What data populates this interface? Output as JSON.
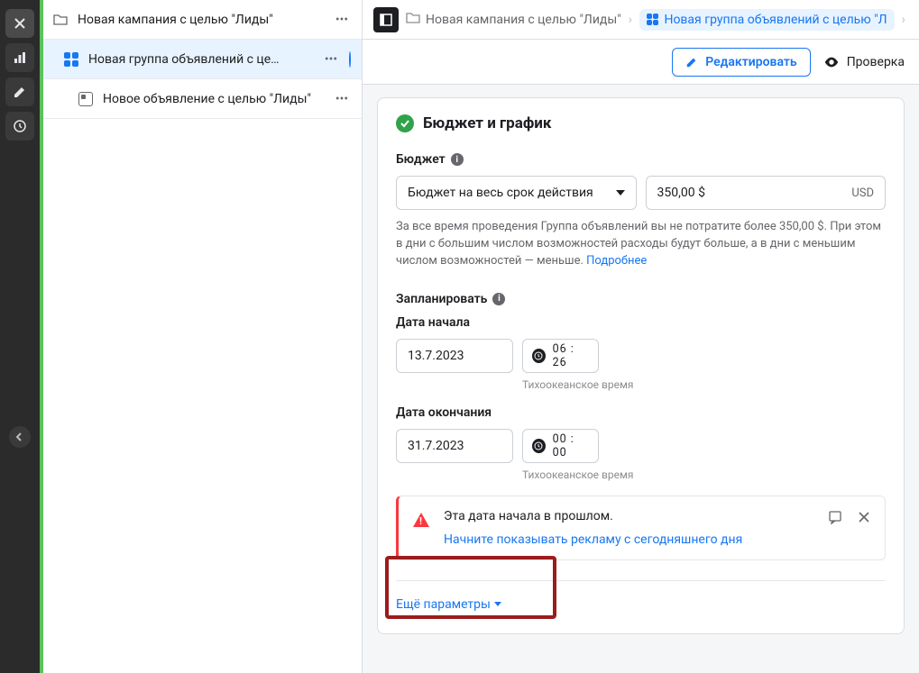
{
  "tree": {
    "campaign": "Новая кампания с целью \"Лиды\"",
    "adset": "Новая группа объявлений с це…",
    "ad": "Новое объявление с целью \"Лиды\""
  },
  "crumbs": {
    "campaign": "Новая кампания с целью \"Лиды\"",
    "adset": "Новая группа объявлений с целью \"Л"
  },
  "actions": {
    "edit": "Редактировать",
    "review": "Проверка"
  },
  "card": {
    "title": "Бюджет и график",
    "budget_label": "Бюджет",
    "budget_type": "Бюджет на весь срок действия",
    "budget_amount": "350,00 $",
    "budget_currency": "USD",
    "budget_help_1": "За все время проведения Группа объявлений вы не потратите более 350,00 $. При этом в дни с большим числом возможностей расходы будут больше, а в дни с меньшим числом возможностей — меньше. ",
    "budget_help_link": "Подробнее",
    "schedule_label": "Запланировать",
    "start_label": "Дата начала",
    "start_date": "13.7.2023",
    "start_time": "06 : 26",
    "end_label": "Дата окончания",
    "end_date": "31.7.2023",
    "end_time": "00 : 00",
    "timezone": "Тихоокеанское время",
    "alert_title": "Эта дата начала в прошлом.",
    "alert_link": "Начните показывать рекламу с сегодняшнего дня",
    "more": "Ещё параметры"
  }
}
